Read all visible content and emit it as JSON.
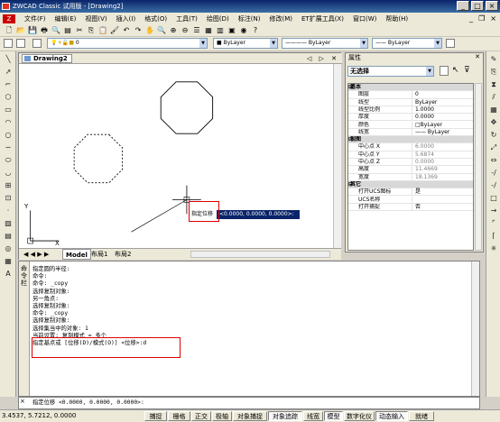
{
  "window": {
    "title": "ZWCAD Classic 试用版 - [Drawing2]"
  },
  "menu": {
    "items": [
      "文件(F)",
      "编辑(E)",
      "视图(V)",
      "插入(I)",
      "格式(O)",
      "工具(T)",
      "绘图(D)",
      "标注(N)",
      "修改(M)",
      "ET扩展工具(X)",
      "窗口(W)",
      "帮助(H)"
    ]
  },
  "toolbar": {
    "layer_value": "0",
    "color_value": "ByLayer",
    "linetype_value": "ByLayer",
    "lineweight_value": "ByLayer"
  },
  "drawing": {
    "tab_title": "Drawing2",
    "tab_controls": "◁ ▷ ✕",
    "prompt_label": "指定位移",
    "prompt_coords": "<0.0000, 0.0000, 0.0000>:",
    "axis_x": "X",
    "axis_y": "Y",
    "layout_tabs": [
      "Model",
      "布局1",
      "布局2"
    ],
    "layout_nav": "◀ ◀ ▶ ▶"
  },
  "properties": {
    "title": "属性",
    "selection": "无选择",
    "rows": [
      {
        "k": "基本",
        "v": "",
        "type": "sec"
      },
      {
        "k": "图层",
        "v": "0"
      },
      {
        "k": "线型",
        "v": "ByLayer"
      },
      {
        "k": "线型比例",
        "v": "1.0000"
      },
      {
        "k": "厚度",
        "v": "0.0000"
      },
      {
        "k": "颜色",
        "v": "□ByLayer"
      },
      {
        "k": "线宽",
        "v": "—— ByLayer"
      },
      {
        "k": "视图",
        "v": "",
        "type": "sec"
      },
      {
        "k": "中心点 X",
        "v": "6.0000",
        "type": "dis"
      },
      {
        "k": "中心点 Y",
        "v": "5.6874",
        "type": "dis"
      },
      {
        "k": "中心点 Z",
        "v": "0.0000",
        "type": "dis"
      },
      {
        "k": "高度",
        "v": "11.4669",
        "type": "dis"
      },
      {
        "k": "宽度",
        "v": "18.1369",
        "type": "dis"
      },
      {
        "k": "其它",
        "v": "",
        "type": "sec"
      },
      {
        "k": "打开UCS图标",
        "v": "是"
      },
      {
        "k": "UCS名称",
        "v": ""
      },
      {
        "k": "打开捕捉",
        "v": "否"
      }
    ]
  },
  "command": {
    "side_label": "命令栏",
    "lines": [
      "指定圆的半径:",
      "命令:",
      "命令: _copy",
      "选择复制对象:",
      "另一角点:",
      "选择复制对象:",
      "命令: _copy",
      "选择复制对象:",
      "选择集当中的对象: 1",
      "当前设置:  复制模式 = 多个",
      "指定基点或 [位移(D)/模式(O)] <位移>:d"
    ],
    "input_line": "指定位移 <0.0000, 0.0000, 0.0000>:"
  },
  "status": {
    "coords": "3.4537, 5.7212, 0.0000",
    "buttons": [
      {
        "label": "捕捉",
        "on": false
      },
      {
        "label": "栅格",
        "on": false
      },
      {
        "label": "正交",
        "on": false
      },
      {
        "label": "极轴",
        "on": false
      },
      {
        "label": "对象捕捉",
        "on": false
      },
      {
        "label": "对象追踪",
        "on": true
      },
      {
        "label": "线宽",
        "on": false
      },
      {
        "label": "模型",
        "on": true
      },
      {
        "label": "数字化仪",
        "on": false
      },
      {
        "label": "动态输入",
        "on": true
      },
      {
        "label": "就绪",
        "on": false
      }
    ]
  },
  "colors": {
    "selection_box": "#e00000",
    "prompt_bg": "#0a246a"
  }
}
